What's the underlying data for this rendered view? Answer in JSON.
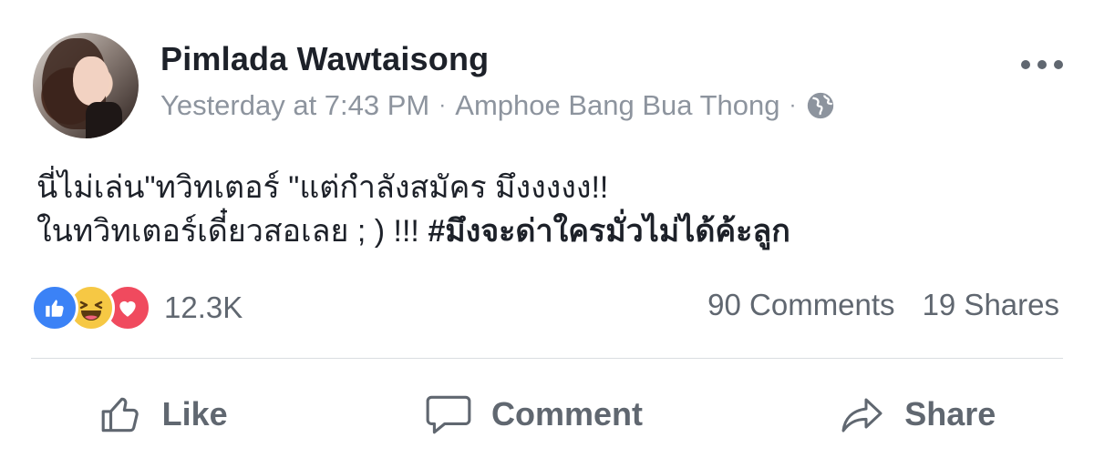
{
  "post": {
    "author": "Pimlada Wawtaisong",
    "timestamp": "Yesterday at 7:43 PM",
    "separator": "·",
    "location": "Amphoe Bang Bua Thong",
    "privacy_icon": "globe-icon",
    "text_line1": "นี่ไม่เล่น\"ทวิทเตอร์ \"แต่กำลังสมัคร มึงงงงง!!",
    "text_line2_plain": "ในทวิทเตอร์เดี๋ยวสอเลย ; ) !!! ",
    "hashtag": "#มึงจะด่าใครมั่วไม่ได้ค้ะลูก"
  },
  "reactions": {
    "icons": [
      "like-reaction-icon",
      "haha-reaction-icon",
      "love-reaction-icon"
    ],
    "count": "12.3K"
  },
  "stats": {
    "comments": "90 Comments",
    "shares": "19 Shares"
  },
  "actions": {
    "like": "Like",
    "comment": "Comment",
    "share": "Share"
  },
  "colors": {
    "name": "#1d2129",
    "meta": "#8d949e",
    "action": "#606770",
    "like_blue": "#3b82f6",
    "love_red": "#f04a5e",
    "haha_yellow": "#f6c844"
  }
}
